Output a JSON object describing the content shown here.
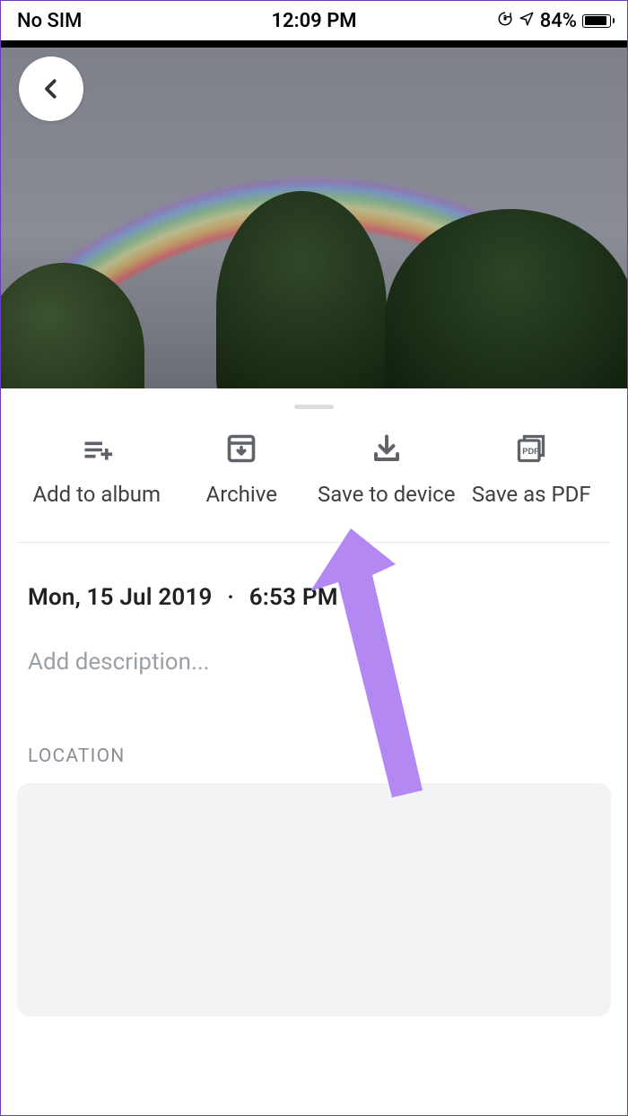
{
  "status_bar": {
    "carrier": "No SIM",
    "time": "12:09 PM",
    "battery_pct": "84%"
  },
  "actions": {
    "add_to_album": "Add to album",
    "archive": "Archive",
    "save_to_device": "Save to device",
    "save_as_pdf": "Save as PDF"
  },
  "photo_info": {
    "date": "Mon, 15 Jul 2019",
    "time": "6:53 PM",
    "description_placeholder": "Add description..."
  },
  "sections": {
    "location_label": "LOCATION"
  }
}
